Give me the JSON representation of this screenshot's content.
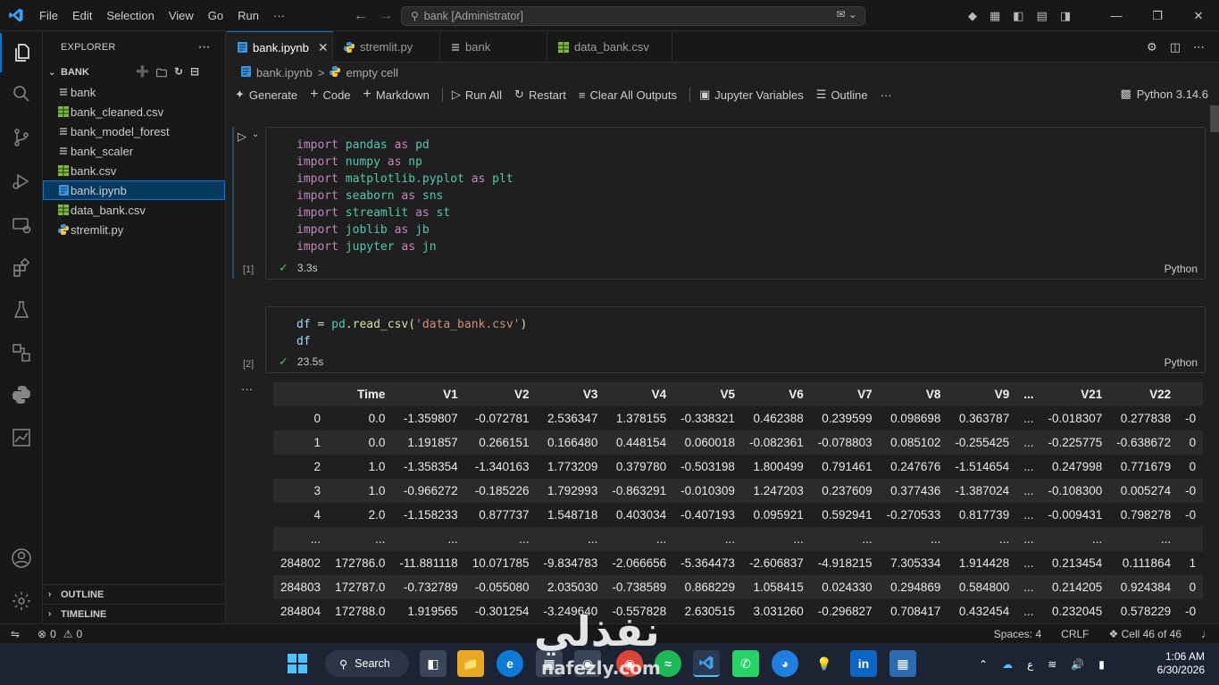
{
  "titlebar": {
    "menu": [
      "File",
      "Edit",
      "Selection",
      "View",
      "Go",
      "Run",
      "···"
    ],
    "command_center": "bank [Administrator]"
  },
  "sidebar": {
    "title": "EXPLORER",
    "folder": "BANK",
    "files": [
      {
        "label": "bank",
        "icon": "lines-file-icon"
      },
      {
        "label": "bank_cleaned.csv",
        "icon": "csv-file-icon"
      },
      {
        "label": "bank_model_forest",
        "icon": "lines-file-icon"
      },
      {
        "label": "bank_scaler",
        "icon": "lines-file-icon"
      },
      {
        "label": "bank.csv",
        "icon": "csv-file-icon"
      },
      {
        "label": "bank.ipynb",
        "icon": "notebook-file-icon",
        "selected": true
      },
      {
        "label": "data_bank.csv",
        "icon": "csv-file-icon"
      },
      {
        "label": "stremlit.py",
        "icon": "python-file-icon"
      }
    ],
    "outline_label": "OUTLINE",
    "timeline_label": "TIMELINE"
  },
  "tabs": [
    {
      "label": "bank.ipynb",
      "active": true
    },
    {
      "label": "stremlit.py"
    },
    {
      "label": "bank"
    },
    {
      "label": "data_bank.csv"
    }
  ],
  "breadcrumb": {
    "file": "bank.ipynb",
    "sep": ">",
    "cell": "empty cell"
  },
  "toolbar": {
    "generate": "Generate",
    "code": "Code",
    "markdown": "Markdown",
    "run_all": "Run All",
    "restart": "Restart",
    "clear_outputs": "Clear All Outputs",
    "variables": "Jupyter Variables",
    "outline": "Outline",
    "more": "···",
    "kernel": "Python 3.14.6"
  },
  "cells": [
    {
      "exec_count": "[1]",
      "time": "3.3s",
      "language": "Python",
      "lines": [
        {
          "kw": "import",
          "mod": "pandas",
          "as": "as",
          "alias": "pd"
        },
        {
          "kw": "import",
          "mod": "numpy",
          "as": "as",
          "alias": "np"
        },
        {
          "kw": "import",
          "mod": "matplotlib.pyplot",
          "as": "as",
          "alias": "plt"
        },
        {
          "kw": "import",
          "mod": "seaborn",
          "as": "as",
          "alias": "sns"
        },
        {
          "kw": "import",
          "mod": "streamlit",
          "as": "as",
          "alias": "st"
        },
        {
          "kw": "import",
          "mod": "joblib",
          "as": "as",
          "alias": "jb"
        },
        {
          "kw": "import",
          "mod": "jupyter",
          "as": "as",
          "alias": "jn"
        }
      ]
    },
    {
      "exec_count": "[2]",
      "time": "23.5s",
      "language": "Python",
      "line1": {
        "var": "df",
        "eq": " = ",
        "obj": "pd",
        "fn": ".read_csv(",
        "str": "'data_bank.csv'",
        "close": ")"
      },
      "line2": "df"
    }
  ],
  "output": {
    "more": "···",
    "columns": [
      "",
      "Time",
      "V1",
      "V2",
      "V3",
      "V4",
      "V5",
      "V6",
      "V7",
      "V8",
      "V9",
      "...",
      "V21",
      "V22",
      ""
    ],
    "rows": [
      [
        "0",
        "0.0",
        "-1.359807",
        "-0.072781",
        "2.536347",
        "1.378155",
        "-0.338321",
        "0.462388",
        "0.239599",
        "0.098698",
        "0.363787",
        "...",
        "-0.018307",
        "0.277838",
        "-0"
      ],
      [
        "1",
        "0.0",
        "1.191857",
        "0.266151",
        "0.166480",
        "0.448154",
        "0.060018",
        "-0.082361",
        "-0.078803",
        "0.085102",
        "-0.255425",
        "...",
        "-0.225775",
        "-0.638672",
        "0"
      ],
      [
        "2",
        "1.0",
        "-1.358354",
        "-1.340163",
        "1.773209",
        "0.379780",
        "-0.503198",
        "1.800499",
        "0.791461",
        "0.247676",
        "-1.514654",
        "...",
        "0.247998",
        "0.771679",
        "0"
      ],
      [
        "3",
        "1.0",
        "-0.966272",
        "-0.185226",
        "1.792993",
        "-0.863291",
        "-0.010309",
        "1.247203",
        "0.237609",
        "0.377436",
        "-1.387024",
        "...",
        "-0.108300",
        "0.005274",
        "-0"
      ],
      [
        "4",
        "2.0",
        "-1.158233",
        "0.877737",
        "1.548718",
        "0.403034",
        "-0.407193",
        "0.095921",
        "0.592941",
        "-0.270533",
        "0.817739",
        "...",
        "-0.009431",
        "0.798278",
        "-0"
      ],
      [
        "...",
        "...",
        "...",
        "...",
        "...",
        "...",
        "...",
        "...",
        "...",
        "...",
        "...",
        "...",
        "...",
        "...",
        ""
      ],
      [
        "284802",
        "172786.0",
        "-11.881118",
        "10.071785",
        "-9.834783",
        "-2.066656",
        "-5.364473",
        "-2.606837",
        "-4.918215",
        "7.305334",
        "1.914428",
        "...",
        "0.213454",
        "0.111864",
        "1"
      ],
      [
        "284803",
        "172787.0",
        "-0.732789",
        "-0.055080",
        "2.035030",
        "-0.738589",
        "0.868229",
        "1.058415",
        "0.024330",
        "0.294869",
        "0.584800",
        "...",
        "0.214205",
        "0.924384",
        "0"
      ],
      [
        "284804",
        "172788.0",
        "1.919565",
        "-0.301254",
        "-3.249640",
        "-0.557828",
        "2.630515",
        "3.031260",
        "-0.296827",
        "0.708417",
        "0.432454",
        "...",
        "0.232045",
        "0.578229",
        "-0"
      ]
    ]
  },
  "statusbar": {
    "errors": "0",
    "warnings": "0",
    "spaces": "Spaces: 4",
    "eol": "CRLF",
    "cell": "Cell 46 of 46"
  },
  "taskbar": {
    "search": "Search",
    "lang": "ع",
    "time": "1:06 AM",
    "date": "6/30/2026",
    "watermark": "نفذلي",
    "watermark_url": "nafezly.com"
  },
  "colors": {
    "accent": "#0078d4",
    "keyword": "#c586c0",
    "module": "#4ec9b0",
    "check": "#4ec263"
  }
}
